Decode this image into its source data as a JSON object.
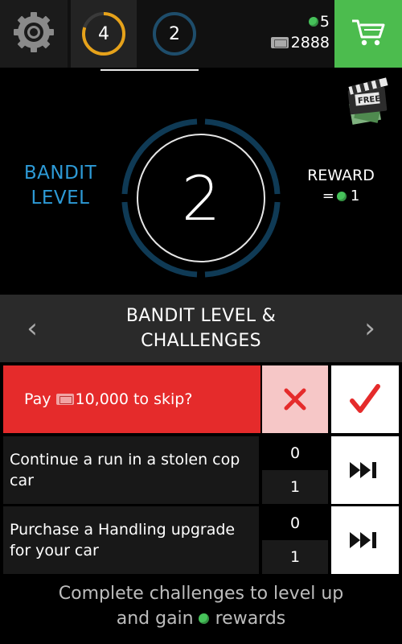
{
  "topbar": {
    "settings_icon": "gear-icon",
    "level_tabs": [
      {
        "number": "4",
        "ring_color": "#e6a21a",
        "progress": 0.8
      },
      {
        "number": "2",
        "ring_color": "#1e4d6b",
        "progress": 1.0
      }
    ],
    "gems": "5",
    "cash": "2888",
    "cart_icon": "shopping-cart-icon",
    "cart_color": "#4cbc4e"
  },
  "hero": {
    "level_label_line1": "BANDIT",
    "level_label_line2": "LEVEL",
    "level_number": "2",
    "level_label_color": "#2d9ad6",
    "reward_title": "REWARD",
    "reward_prefix": "=",
    "reward_amount": "1",
    "free_ad_label": "FREE"
  },
  "section": {
    "title_line1": "BANDIT LEVEL &",
    "title_line2": "CHALLENGES",
    "left_arrow": "‹",
    "right_arrow": "›"
  },
  "skip": {
    "prefix": "Pay",
    "amount": "10,000",
    "suffix": "to skip?",
    "decline_icon": "x-icon",
    "accept_icon": "checkmark-icon",
    "accent": "#e52b2b"
  },
  "challenges": [
    {
      "line1": "Continue a run in a stolen cop",
      "line2": "car",
      "progress": "0",
      "target": "1"
    },
    {
      "line1": "Purchase a Handling upgrade",
      "line2": "for your car",
      "progress": "0",
      "target": "1"
    }
  ],
  "footer": {
    "line1": "Complete challenges to level up",
    "line2_before": "and gain",
    "line2_after": "rewards"
  }
}
